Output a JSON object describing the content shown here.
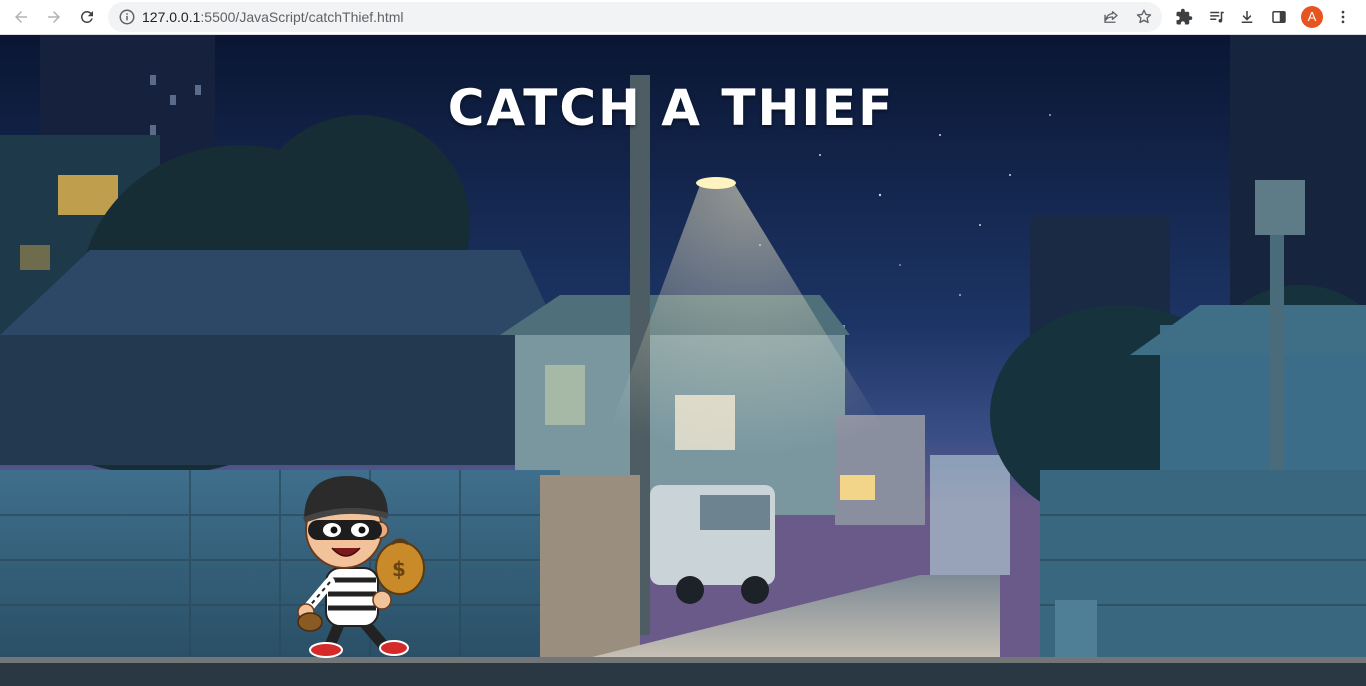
{
  "browser": {
    "url_host": "127.0.0.1",
    "url_path": ":5500/JavaScript/catchThief.html",
    "profile_initial": "A",
    "icons": {
      "back": "arrow-left-icon",
      "forward": "arrow-right-icon",
      "reload": "reload-icon",
      "site_info": "info-icon",
      "share": "share-icon",
      "bookmark": "star-icon",
      "extensions": "puzzle-icon",
      "media": "playlist-icon",
      "downloads": "download-icon",
      "side_panel": "side-panel-icon",
      "menu": "kebab-menu-icon"
    },
    "accent_color": "#e8541f"
  },
  "game": {
    "title": "CATCH A THIEF",
    "background": "night-street-scene",
    "character": "thief-with-money-bag"
  }
}
